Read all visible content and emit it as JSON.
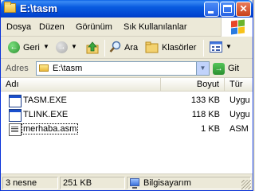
{
  "window": {
    "title": "E:\\tasm"
  },
  "menu": {
    "items": [
      "Dosya",
      "Düzen",
      "Görünüm",
      "Sık Kullanılanlar"
    ]
  },
  "toolbar": {
    "back_label": "Geri",
    "search_label": "Ara",
    "folders_label": "Klasörler"
  },
  "address": {
    "label": "Adres",
    "value": "E:\\tasm",
    "go_label": "Git"
  },
  "columns": {
    "name": "Adı",
    "size": "Boyut",
    "type": "Tür"
  },
  "files": [
    {
      "name": "TASM.EXE",
      "size": "133 KB",
      "type": "Uygu",
      "icon": "exe-icon"
    },
    {
      "name": "TLINK.EXE",
      "size": "118 KB",
      "type": "Uygu",
      "icon": "exe-icon"
    },
    {
      "name": "merhaba.asm",
      "size": "1 KB",
      "type": "ASM",
      "icon": "text-file-icon"
    }
  ],
  "status": {
    "objects": "3 nesne",
    "size": "251 KB",
    "location": "Bilgisayarım"
  },
  "colors": {
    "titlebar": "#0a5ce0",
    "chrome": "#ece9d8",
    "go": "#2a8f2f",
    "back": "#2a8f2f"
  }
}
